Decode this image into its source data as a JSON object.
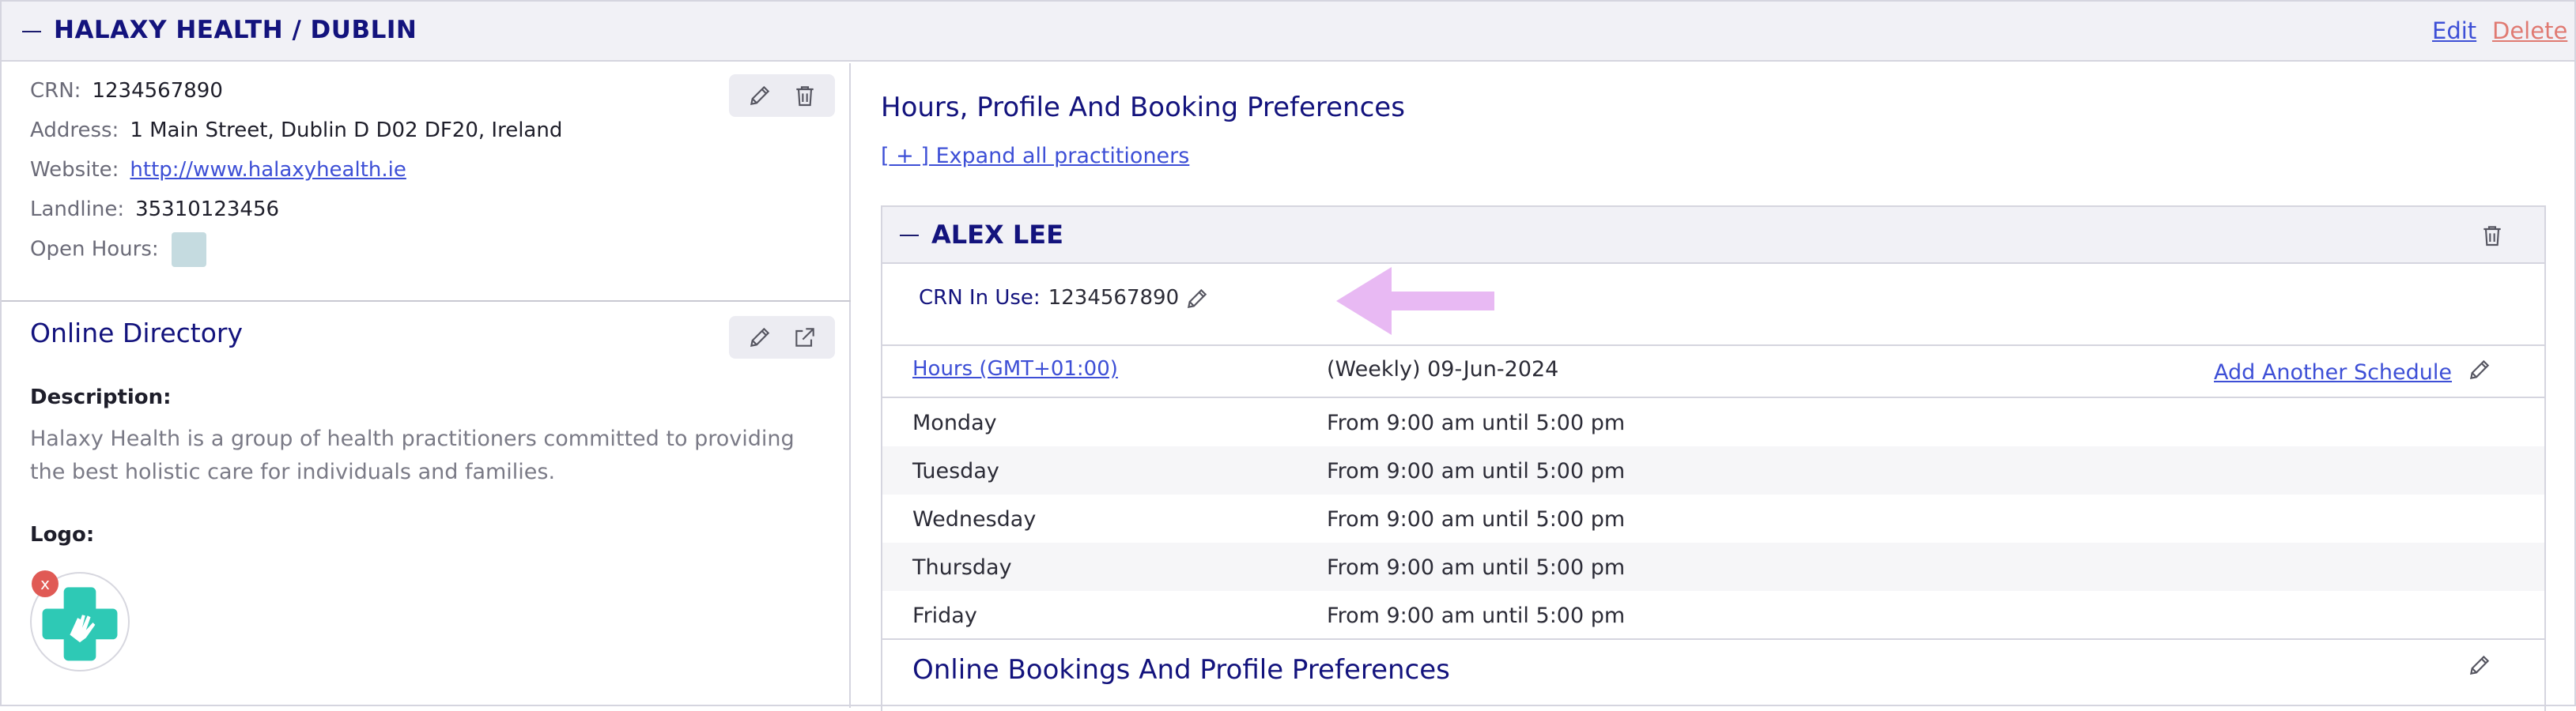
{
  "header": {
    "title": "HALAXY HEALTH / DUBLIN",
    "edit_label": "Edit",
    "delete_label": "Delete"
  },
  "organisation": {
    "crn_label": "CRN:",
    "crn_value": "1234567890",
    "address_label": "Address:",
    "address_value": "1 Main Street, Dublin D D02 DF20, Ireland",
    "website_label": "Website:",
    "website_value": "http://www.halaxyhealth.ie",
    "landline_label": "Landline:",
    "landline_value": "35310123456",
    "open_hours_label": "Open Hours:"
  },
  "directory": {
    "title": "Online Directory",
    "description_label": "Description:",
    "description_text": "Halaxy Health is a group of health practitioners committed to providing the best holistic care for individuals and families.",
    "logo_label": "Logo:",
    "logo_remove": "x"
  },
  "preferences": {
    "title": "Hours, Profile And Booking Preferences",
    "expand_label": "[ + ] Expand all practitioners"
  },
  "practitioner": {
    "name": "ALEX LEE",
    "crn_label": "CRN In Use:",
    "crn_value": "1234567890",
    "hours_link": "Hours (GMT+01:00)",
    "schedule_label": "(Weekly) 09-Jun-2024",
    "add_schedule_label": "Add Another Schedule",
    "days": [
      {
        "day": "Monday",
        "hours": "From 9:00 am until 5:00 pm"
      },
      {
        "day": "Tuesday",
        "hours": "From 9:00 am until 5:00 pm"
      },
      {
        "day": "Wednesday",
        "hours": "From 9:00 am until 5:00 pm"
      },
      {
        "day": "Thursday",
        "hours": "From 9:00 am until 5:00 pm"
      },
      {
        "day": "Friday",
        "hours": "From 9:00 am until 5:00 pm"
      }
    ],
    "bookings_title": "Online Bookings And Profile Preferences"
  },
  "colors": {
    "accent": "#13137d",
    "link": "#3d4fd6",
    "delete": "#e07a72",
    "arrow": "#e8b9f3",
    "logo_teal": "#2ec9b5"
  },
  "icons": [
    "pencil-icon",
    "trash-icon",
    "external-link-icon",
    "arrow-left-icon",
    "collapse-icon"
  ]
}
